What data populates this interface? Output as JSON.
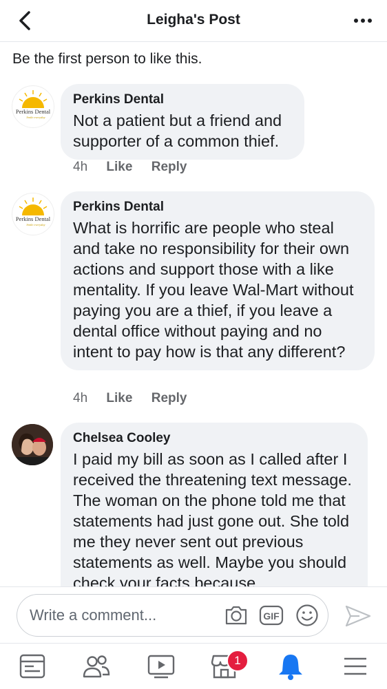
{
  "header": {
    "title": "Leigha's Post"
  },
  "likes_line": "Be the first person to like this.",
  "comments": [
    {
      "author": "Perkins Dental",
      "text": "Not a patient but a friend and supporter of a common thief.",
      "time": "4h",
      "like_label": "Like",
      "reply_label": "Reply",
      "avatar_text": "Perkins Dental",
      "avatar_subtext": "Smile everyday"
    },
    {
      "author": "Perkins Dental",
      "text": "What is horrific are people who steal and take no responsibility for their own actions and support those with a like mentality.  If you leave Wal-Mart without paying you are a thief, if you leave a dental office without paying and no intent to pay how is that any different?",
      "time": "4h",
      "like_label": "Like",
      "reply_label": "Reply",
      "avatar_text": "Perkins Dental",
      "avatar_subtext": "Smile everyday"
    },
    {
      "author": "Chelsea Cooley",
      "text": "I paid my bill as soon as I called after I received the threatening text message. The woman on the phone told me that statements had just gone out. She told me they never sent out previous statements as well. Maybe you should check your facts because"
    }
  ],
  "composer": {
    "placeholder": "Write a comment...",
    "gif_label": "GIF"
  },
  "tabbar": {
    "marketplace_badge": "1"
  },
  "colors": {
    "accent": "#1877f2",
    "bubble": "#f0f2f5",
    "badge": "#e41e3f"
  }
}
